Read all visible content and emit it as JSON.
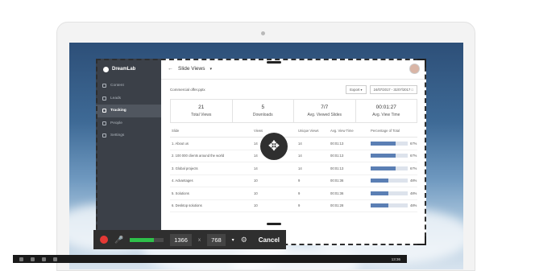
{
  "app": {
    "brand": "DreamLab",
    "page_title": "Slide Views",
    "file_name": "Commercial offer.pptx",
    "export_label": "Export",
    "date_range": "24/07/2017 - 31/07/2017"
  },
  "sidebar": {
    "items": [
      {
        "label": "Content",
        "icon": "content-icon"
      },
      {
        "label": "Leads",
        "icon": "leads-icon"
      },
      {
        "label": "Tracking",
        "icon": "tracking-icon",
        "active": true
      },
      {
        "label": "People",
        "icon": "people-icon"
      },
      {
        "label": "Settings",
        "icon": "settings-icon"
      }
    ]
  },
  "stats": [
    {
      "value": "21",
      "label": "Total Views"
    },
    {
      "value": "5",
      "label": "Downloads"
    },
    {
      "value": "7/7",
      "label": "Avg. Viewed Slides"
    },
    {
      "value": "00:01:27",
      "label": "Avg. View Time"
    }
  ],
  "table": {
    "headers": [
      "Slide",
      "Views",
      "Unique Views",
      "Avg. View Time",
      "Percentage of Total"
    ],
    "rows": [
      {
        "slide": "1. About us",
        "views": "14",
        "unique": "14",
        "time": "00:01:13",
        "pct": "67%",
        "pct_value": 67
      },
      {
        "slide": "2. 100 000 clients around the world",
        "views": "14",
        "unique": "14",
        "time": "00:01:13",
        "pct": "67%",
        "pct_value": 67
      },
      {
        "slide": "3. Global projects",
        "views": "14",
        "unique": "14",
        "time": "00:01:13",
        "pct": "67%",
        "pct_value": 67
      },
      {
        "slide": "4. Advantages",
        "views": "10",
        "unique": "9",
        "time": "00:01:36",
        "pct": "48%",
        "pct_value": 48
      },
      {
        "slide": "5. Solutions",
        "views": "10",
        "unique": "9",
        "time": "00:01:36",
        "pct": "48%",
        "pct_value": 48
      },
      {
        "slide": "6. Desktop solutions",
        "views": "10",
        "unique": "9",
        "time": "00:01:28",
        "pct": "48%",
        "pct_value": 48
      }
    ]
  },
  "recorder": {
    "width": "1366",
    "height": "768",
    "times": "x",
    "cancel_label": "Cancel",
    "mic_level": 0.7,
    "colors": {
      "record": "#e53935",
      "level": "#2ec04a"
    }
  },
  "taskbar": {
    "clock": "13:36"
  }
}
